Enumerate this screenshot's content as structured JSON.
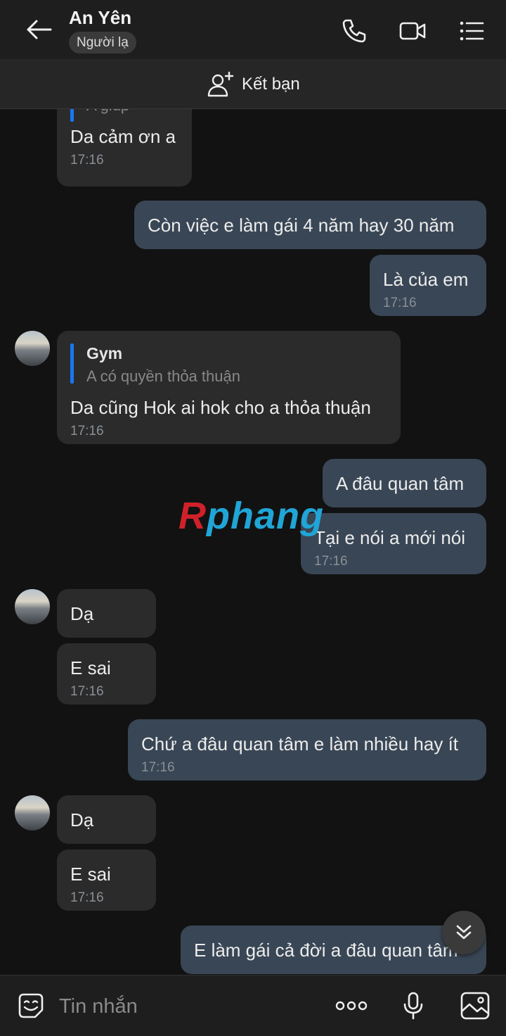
{
  "header": {
    "title": "An Yên",
    "badge": "Người lạ",
    "icons": [
      "back-arrow-icon",
      "phone-icon",
      "video-call-icon",
      "menu-list-icon"
    ]
  },
  "friend_bar": {
    "label": "Kết bạn",
    "icon": "add-friend-icon"
  },
  "messages": {
    "m1": {
      "quote_text": "A giúp",
      "text": "Da cảm ơn a",
      "time": "17:16"
    },
    "m2": {
      "text": "Còn việc e làm gái 4 năm hay 30 năm"
    },
    "m3": {
      "text": "Là của em",
      "time": "17:16"
    },
    "m4": {
      "quote_name": "Gym",
      "quote_text": "A có quyền thỏa thuận",
      "text": "Da cũng Hok ai hok cho a thỏa thuận",
      "time": "17:16"
    },
    "m5": {
      "text": "A đâu quan tâm"
    },
    "m6": {
      "text": "Tại e nói a mới nói",
      "time": "17:16"
    },
    "m7": {
      "text": "Dạ"
    },
    "m8": {
      "text": "E sai",
      "time": "17:16"
    },
    "m9": {
      "text": "Chứ a đâu quan tâm e làm nhiều hay ít",
      "time": "17:16"
    },
    "m10": {
      "text": "Dạ"
    },
    "m11": {
      "text": "E sai",
      "time": "17:16"
    },
    "m12": {
      "text": "E làm gái cả đời a đâu quan tâm"
    }
  },
  "watermark": {
    "first": "R",
    "rest": "phang"
  },
  "input_bar": {
    "placeholder": "Tin nhắn"
  },
  "colors": {
    "incoming_bubble": "#2b2b2b",
    "outgoing_bubble": "#394655",
    "quote_bar": "#1877f2",
    "background": "#121212"
  }
}
